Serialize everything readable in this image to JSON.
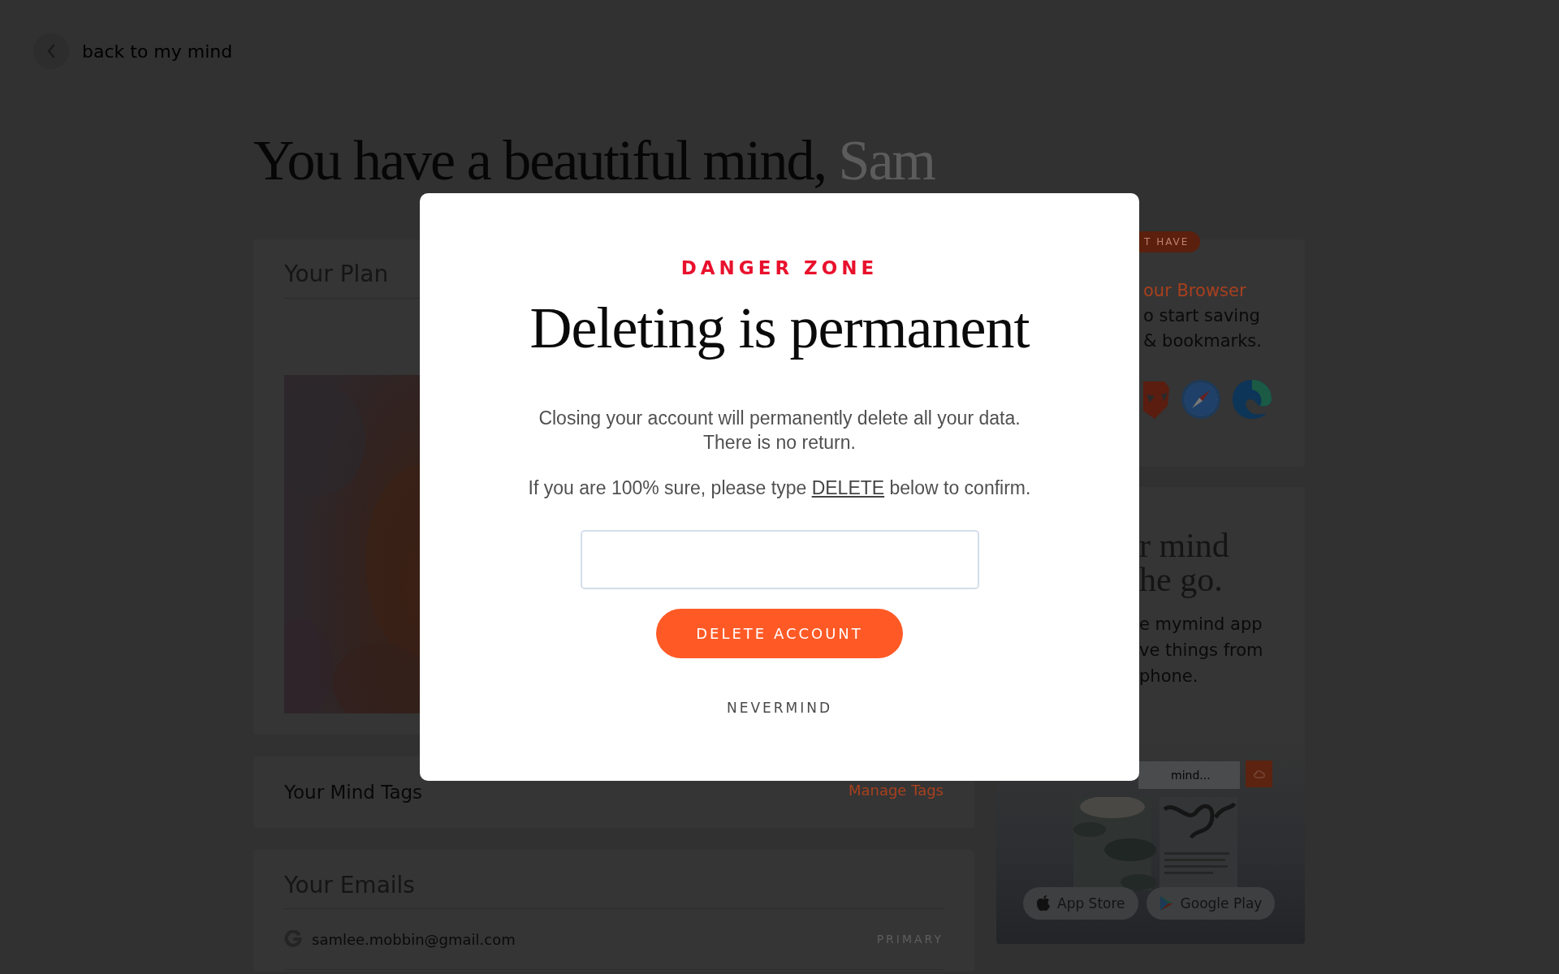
{
  "back_link": {
    "label": "back to my mind"
  },
  "heading": {
    "text": "You have a beautiful mind,",
    "name": "Sam"
  },
  "plan_card": {
    "title": "Your Plan"
  },
  "tags_card": {
    "title": "Your Mind Tags",
    "link": "Manage Tags"
  },
  "emails_card": {
    "title": "Your Emails",
    "emails": [
      {
        "address": "samlee.mobbin@gmail.com",
        "badge": "PRIMARY"
      }
    ]
  },
  "browser_card": {
    "badge": "T HAVE",
    "link": "our Browser",
    "text_lines": [
      "o start saving",
      "& bookmarks."
    ]
  },
  "app_card": {
    "title_lines": [
      "r mind",
      "he go."
    ],
    "text_lines": [
      "e mymind app",
      "ve things from",
      "phone."
    ],
    "search_placeholder": "mind...",
    "store_buttons": [
      {
        "kind": "apple",
        "label": "App Store"
      },
      {
        "kind": "google",
        "label": "Google Play"
      }
    ]
  },
  "modal": {
    "eyebrow": "DANGER ZONE",
    "title": "Deleting is permanent",
    "message_lines": [
      "Closing your account will permanently delete all your data.",
      "There is no return."
    ],
    "instruction": {
      "before": "If you are 100% sure, please type",
      "keyword": "DELETE",
      "after": "below to confirm."
    },
    "primary_button": "DELETE ACCOUNT",
    "cancel_link": "NEVERMIND"
  }
}
